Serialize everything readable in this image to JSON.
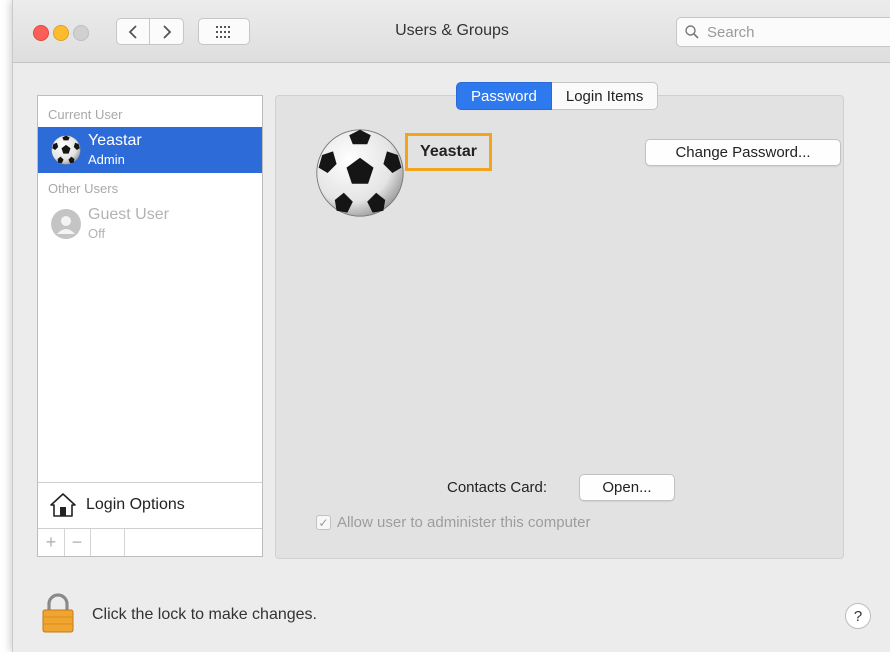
{
  "window": {
    "title": "Users & Groups"
  },
  "search": {
    "placeholder": "Search"
  },
  "sidebar": {
    "current_user_header": "Current User",
    "other_users_header": "Other Users",
    "users": [
      {
        "name": "Yeastar",
        "role": "Admin",
        "selected": true
      },
      {
        "name": "Guest User",
        "role": "Off",
        "selected": false
      }
    ],
    "login_options_label": "Login Options",
    "add_label": "+",
    "remove_label": "−"
  },
  "tabs": [
    {
      "label": "Password",
      "active": true
    },
    {
      "label": "Login Items",
      "active": false
    }
  ],
  "detail": {
    "user_name": "Yeastar",
    "change_password_label": "Change Password...",
    "contacts_card_label": "Contacts Card:",
    "open_label": "Open...",
    "admin_checkbox_label": "Allow user to administer this computer",
    "admin_checked": true
  },
  "footer": {
    "lock_text": "Click the lock to make changes.",
    "help_label": "?"
  },
  "colors": {
    "selection": "#2d6cd8",
    "tab_active": "#2f79ef",
    "highlight_box": "#f2a51c",
    "lock": "#f0a531"
  }
}
